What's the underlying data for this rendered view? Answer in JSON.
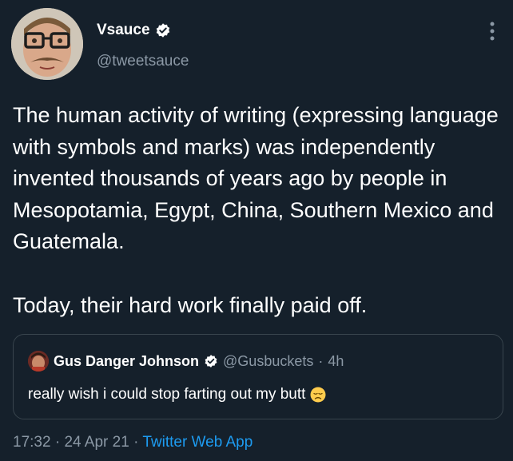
{
  "author": {
    "name": "Vsauce",
    "handle": "@tweetsauce"
  },
  "tweet": {
    "paragraph_1": "The human activity of writing (expressing language with symbols and marks) was independently invented thousands of years ago by people in Mesopotamia, Egypt, China, Southern Mexico and Guatemala.",
    "paragraph_2": "Today, their hard work finally paid off."
  },
  "quoted_tweet": {
    "name": "Gus Danger Johnson",
    "handle": "@Gusbuckets",
    "separator": "·",
    "time": "4h",
    "text": "really wish i could stop farting out my butt",
    "emoji": "disappointed-face"
  },
  "meta": {
    "time": "17:32",
    "separator_1": "·",
    "date": "24 Apr 21",
    "separator_2": "·",
    "source": "Twitter Web App"
  },
  "colors": {
    "background": "#15202b",
    "text": "#ffffff",
    "secondary": "#8b98a5",
    "accent": "#1d9bf0",
    "border": "#38444d"
  },
  "icons": [
    "verified-badge-icon",
    "more-options-icon",
    "disappointed-face-emoji"
  ]
}
